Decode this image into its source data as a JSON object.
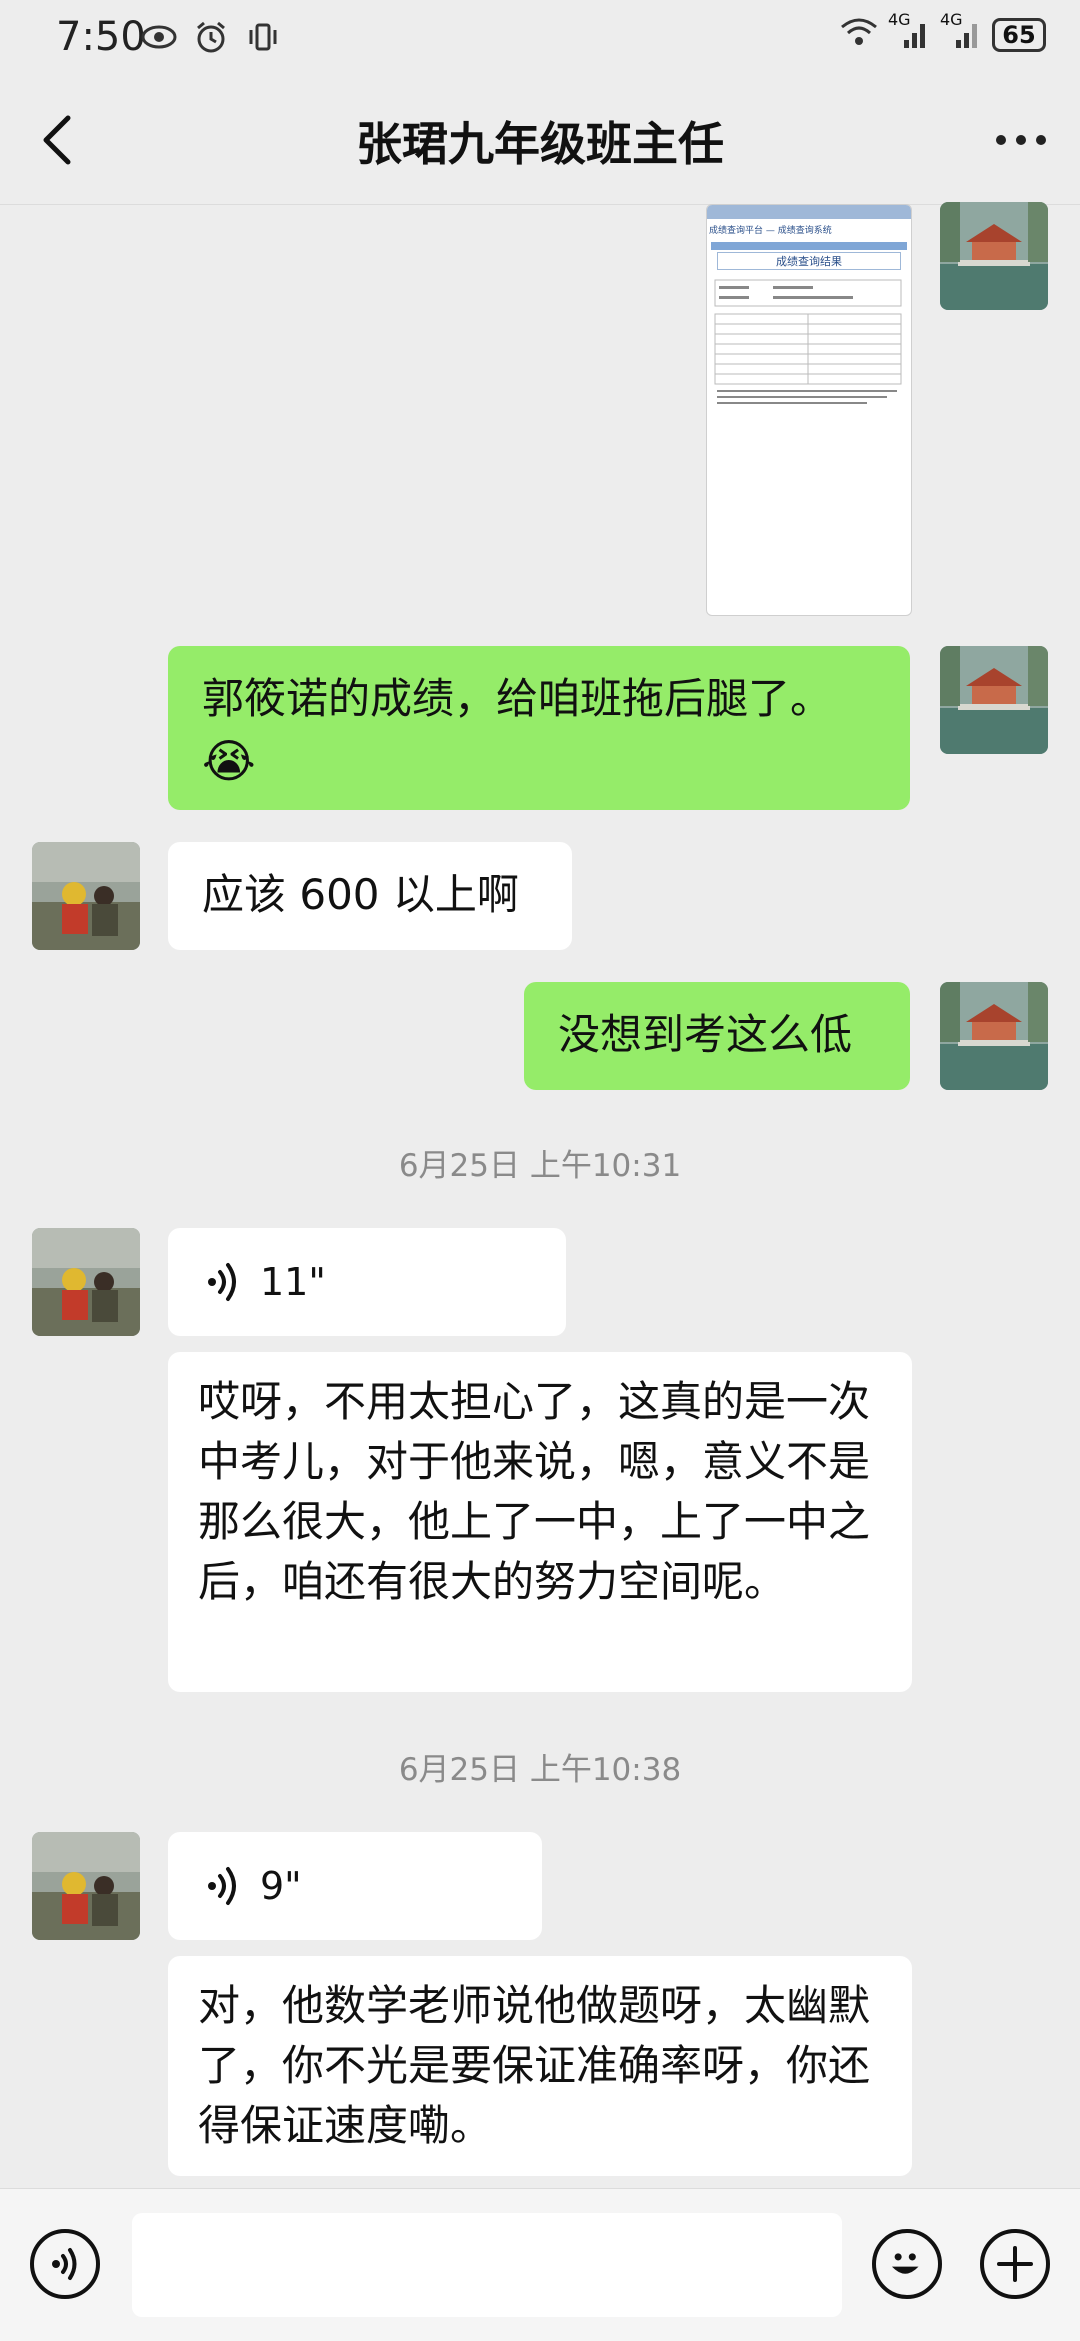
{
  "status_bar": {
    "time": "7:50",
    "battery": "65",
    "network_1": "4G",
    "network_2": "4G"
  },
  "header": {
    "title": "张珺九年级班主任"
  },
  "shared_image": {
    "page_header": "成绩查询平台 — 成绩查询系统",
    "card_title": "成绩查询结果"
  },
  "messages": {
    "m1": "郭筱诺的成绩，给咱班拖后腿了。",
    "m1_emoji": "😭",
    "m2": "应该 600 以上啊",
    "m3": "没想到考这么低",
    "ts1": "6月25日 上午10:31",
    "voice1": "11\"",
    "m4": "哎呀，不用太担心了，这真的是一次中考儿，对于他来说，嗯，意义不是那么很大，他上了一中，上了一中之后，咱还有很大的努力空间呢。",
    "ts2": "6月25日 上午10:38",
    "voice2": "9\"",
    "m5": "对，他数学老师说他做题呀，太幽默了，你不光是要保证准确率呀，你还得保证速度嘞。"
  },
  "colors": {
    "background": "#ededed",
    "my_bubble": "#95ec69",
    "other_bubble": "#ffffff",
    "timestamp": "#8a8a8a"
  },
  "icons": {
    "voice_input": "voice-icon",
    "emoji": "smiley-icon",
    "add": "plus-icon"
  }
}
